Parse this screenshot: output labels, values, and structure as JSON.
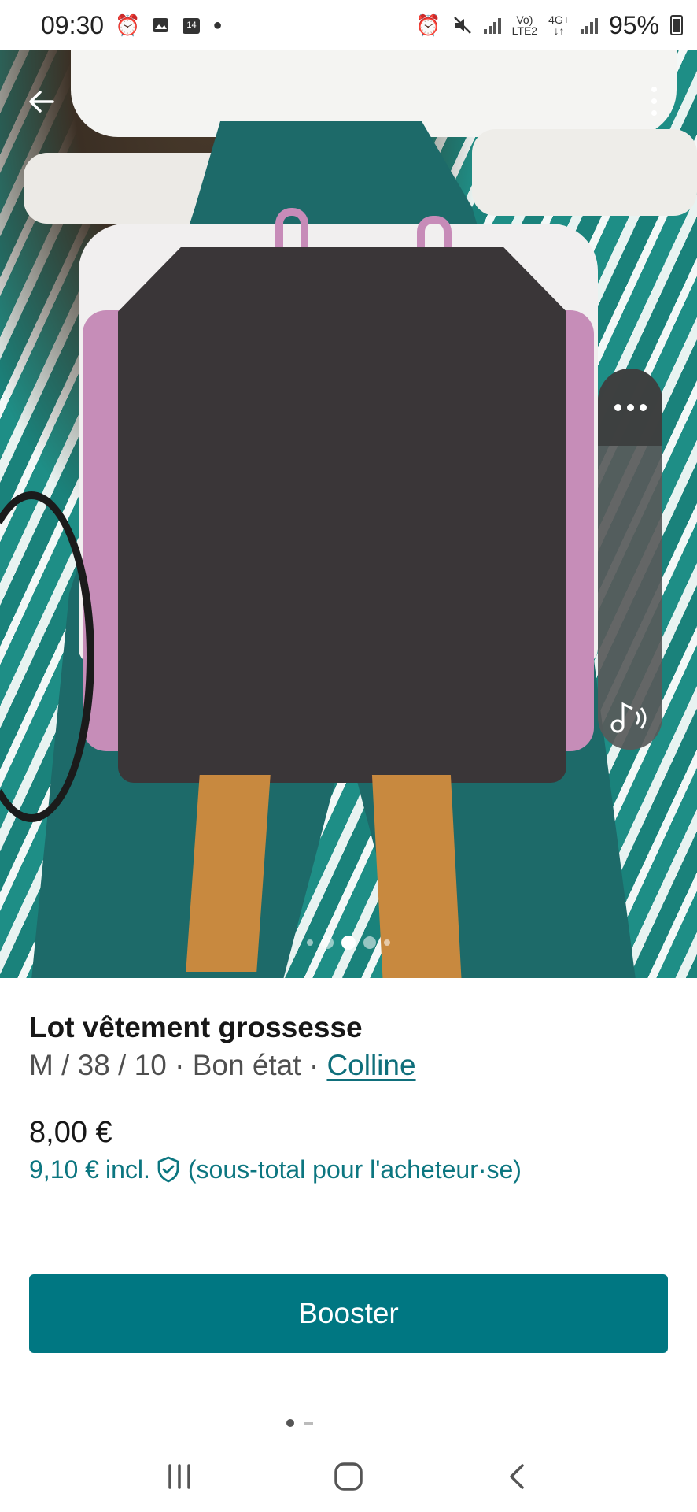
{
  "status_bar": {
    "time": "09:30",
    "calendar_day": "14",
    "network_top": "Vo)",
    "network_bottom": "LTE2",
    "data_type": "4G+",
    "battery": "95%"
  },
  "photo": {
    "image_count": 5,
    "active_index": 3
  },
  "listing": {
    "title": "Lot vêtement grossesse",
    "size": "M / 38 / 10",
    "separator": " · ",
    "condition": "Bon état",
    "brand": "Colline",
    "price": "8,00 €",
    "total_price": "9,10 €",
    "incl_label": "incl.",
    "buyer_note": "(sous-total pour l'acheteur·se)"
  },
  "actions": {
    "boost_label": "Booster"
  },
  "colors": {
    "accent": "#007782",
    "link": "#0f6f7b"
  },
  "icons": {
    "back": "arrow-left-icon",
    "more": "more-vertical-icon",
    "shield": "shield-check-icon",
    "sound": "music-note-sound-icon",
    "nav_recents": "recents-icon",
    "nav_home": "home-icon",
    "nav_back": "chevron-left-icon"
  }
}
